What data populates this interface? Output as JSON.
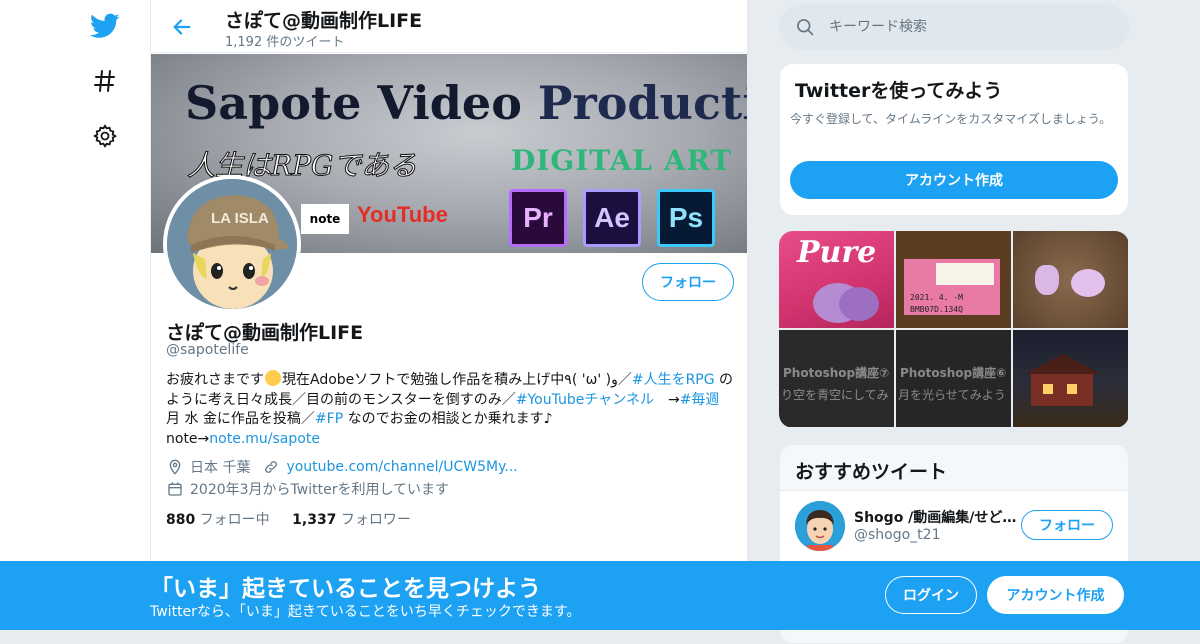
{
  "nav": {
    "icons": [
      "twitter-bird-icon",
      "hashtag-icon",
      "gear-icon"
    ]
  },
  "topbar": {
    "title": "さぽて@動画制作LIFE",
    "tweet_count": "1,192 件のツイート"
  },
  "banner": {
    "title_a": "Sapote Video ",
    "title_b": "Production",
    "tagline": "人生はRPGである",
    "digital": "DIGITAL ART",
    "note": "note",
    "youtube": "YouTube",
    "apps": [
      "Pr",
      "Ae",
      "Ps"
    ]
  },
  "profile": {
    "follow_label": "フォロー",
    "name": "さぽて@動画制作LIFE",
    "handle": "@sapotelife",
    "bio_1": "お疲れさまです",
    "bio_2": "現在Adobeソフトで勉強し作品を積み上げ中٩( 'ω' )و／",
    "bio_tag_1": "#人生をRPG",
    "bio_3": " のように考え日々成長／目の前のモンスターを倒すのみ／",
    "bio_tag_2": "#YouTubeチャンネル",
    "bio_4": "　→",
    "bio_tag_3": "#毎週",
    "bio_5": " 月 水 金に作品を投稿／",
    "bio_tag_4": "#FP",
    "bio_6": " なのでお金の相談とか乗れます♪",
    "bio_7": "note→",
    "bio_link": "note.mu/sapote",
    "location": "日本 千葉",
    "website": "youtube.com/channel/UCW5My...",
    "joined": "2020年3月からTwitterを利用しています",
    "following_count": "880",
    "following_label": "フォロー中",
    "followers_count": "1,337",
    "followers_label": "フォロワー"
  },
  "search": {
    "placeholder": "キーワード検索"
  },
  "signup_card": {
    "title": "Twitterを使ってみよう",
    "desc": "今すぐ登録して、タイムラインをカスタマイズしましょう。",
    "button": "アカウント作成"
  },
  "media": {
    "pure_text": "Pure",
    "pkg_date": "2021. 4. -M",
    "pkg_code": "BMB07D.134Q",
    "ps_label_1": "Photoshop講座⑦",
    "ps_sub_1": "り空を青空にしてみ",
    "ps_label_2": "Photoshop講座⑥",
    "ps_sub_2": "月を光らせてみよう"
  },
  "recommend": {
    "title": "おすすめツイート",
    "user_name": "Shogo /動画編集/せどり/物販",
    "user_handle": "@shogo_t21",
    "follow_label": "フォロー"
  },
  "bottom": {
    "title": "「いま」起きていることを見つけよう",
    "sub": "Twitterなら、「いま」起きていることをいち早くチェックできます。",
    "login": "ログイン",
    "signup": "アカウント作成"
  },
  "colors": {
    "brand": "#1da1f2",
    "link": "#1b95e0",
    "muted": "#657786"
  }
}
